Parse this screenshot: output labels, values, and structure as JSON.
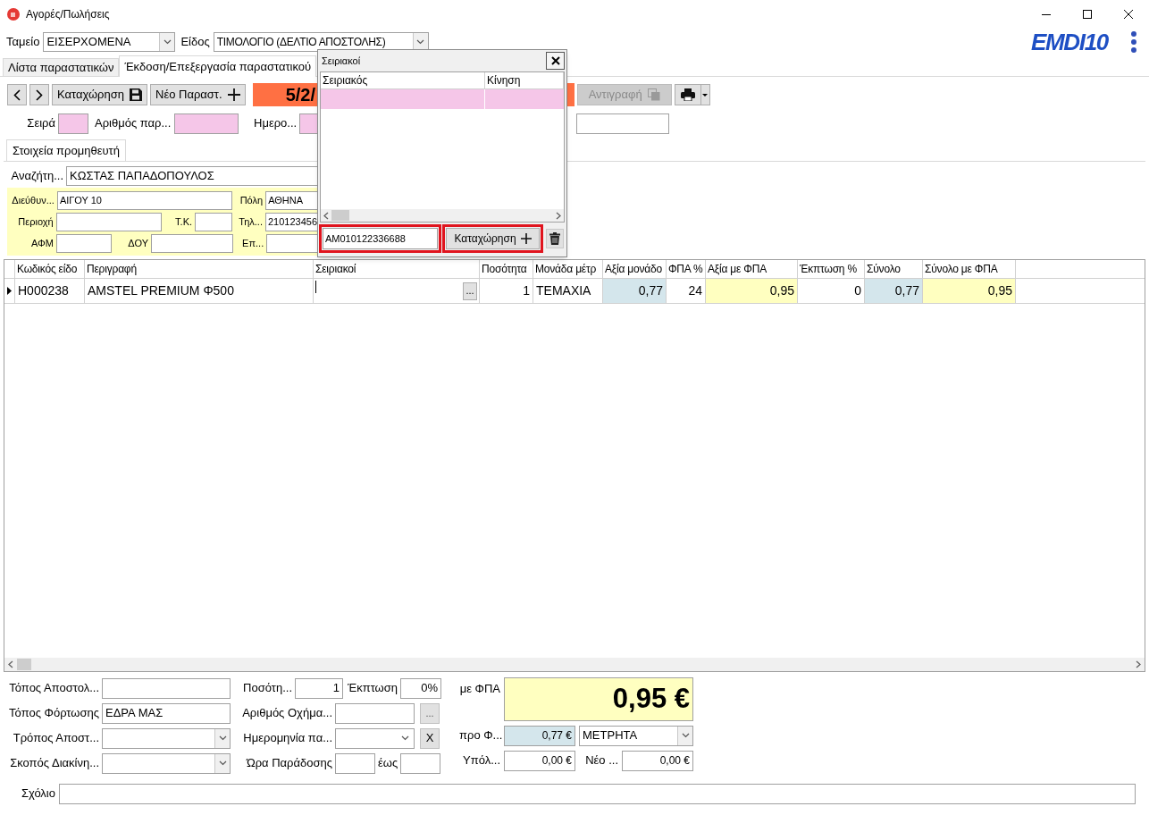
{
  "window": {
    "title": "Αγορές/Πωλήσεις"
  },
  "header": {
    "cash_box": {
      "label": "Ταμείο",
      "value": "ΕΙΣΕΡΧΟΜΕΝΑ"
    },
    "doc_type": {
      "label": "Είδος",
      "value": "ΤΙΜΟΛΟΓΙΟ (ΔΕΛΤΙΟ ΑΠΟΣΤΟΛΗΣ)"
    },
    "logo": "EMDI10"
  },
  "tabs": [
    {
      "label": "Λίστα παραστατικών",
      "selected": false
    },
    {
      "label": "Έκδοση/Επεξεργασία παραστατικού",
      "selected": true
    }
  ],
  "toolbar": {
    "buttons": [
      {
        "kind": "prev",
        "disabled": false
      },
      {
        "kind": "next",
        "disabled": false
      },
      {
        "kind": "save",
        "label": "Καταχώρηση",
        "disabled": false
      },
      {
        "kind": "new",
        "label": "Νέο Παραστ.",
        "disabled": false
      }
    ],
    "date_banner": "5/2/",
    "copy_button": {
      "label": "Αντιγραφή",
      "disabled": true
    }
  },
  "document_fields": [
    {
      "label": "Σειρά",
      "highlighted": true
    },
    {
      "label": "Αριθμός παρ...",
      "highlighted": true
    },
    {
      "label": "Ημερο...",
      "highlighted": true
    },
    {
      "highlighted": false
    }
  ],
  "supplier": {
    "tab": "Στοιχεία προμηθευτή",
    "search": {
      "label": "Αναζήτη...",
      "value": "ΚΩΣΤΑΣ ΠΑΠΑΔΟΠΟΥΛΟΣ"
    },
    "address": {
      "label": "Διεύθυν...",
      "value": "ΑΙΓΟΥ 10"
    },
    "city": {
      "label": "Πόλη",
      "value": "ΑΘΗΝΑ"
    },
    "area": {
      "label": "Περιοχή"
    },
    "postal_code": {
      "label": "Τ.Κ."
    },
    "phone": {
      "label": "Τηλ...",
      "value": "210123456"
    },
    "tax_id": {
      "label": "ΑΦΜ"
    },
    "tax_office": {
      "label": "ΔΟΥ"
    },
    "field_9": {
      "label": "Επ..."
    }
  },
  "grid": {
    "columns": [
      "Κωδικός είδο",
      "Περιγραφή",
      "Σειριακοί",
      "Ποσότητα",
      "Μονάδα μέτρ",
      "Αξία μονάδο",
      "ΦΠΑ %",
      "Αξία με ΦΠΑ",
      "Έκπτωση %",
      "Σύνολο",
      "Σύνολο με ΦΠΑ"
    ],
    "rows": [
      {
        "current": true,
        "code": "H000238",
        "description": "AMSTEL PREMIUM Φ500",
        "serial_button": "...",
        "quantity": "1",
        "unit": "ΤΕΜΑΧΙΑ",
        "unit_value": "0,77",
        "vat_percent": "24",
        "value_with_vat": "0,95",
        "discount_percent": "0",
        "total": "0,77",
        "total_with_vat": "0,95"
      }
    ]
  },
  "serials_dialog": {
    "title": "Σειριακοί",
    "columns": [
      "Σειριακός",
      "Κίνηση"
    ],
    "rows": [
      {
        "highlighted": true
      }
    ],
    "input": "AM010122336688",
    "add_button": "Καταχώρηση"
  },
  "footer": {
    "left": [
      {
        "label": "Τόπος Αποστολ...",
        "kind": "text"
      },
      {
        "label": "Τόπος Φόρτωσης",
        "kind": "text",
        "value": "ΕΔΡΑ ΜΑΣ"
      },
      {
        "label": "Τρόπος Αποστ...",
        "kind": "combo"
      },
      {
        "label": "Σκοπός Διακίνη...",
        "kind": "combo"
      }
    ],
    "quantity": {
      "label": "Ποσότη...",
      "value": "1"
    },
    "discount": {
      "label": "Έκπτωση",
      "value": "0%"
    },
    "vehicle": {
      "label": "Αριθμός Οχήμα...",
      "button": "..."
    },
    "delivery_date": {
      "label": "Ημερομηνία πα...",
      "clear_button": "X"
    },
    "delivery_time": {
      "label": "Ώρα Παράδοσης",
      "to_label": "έως"
    },
    "total_with_vat": {
      "label": "με ΦΠΑ",
      "value": "0,95 €"
    },
    "total_before_vat": {
      "label": "προ Φ...",
      "value": "0,77 €"
    },
    "payment": {
      "value": "ΜΕΤΡΗΤΑ"
    },
    "balance": {
      "label": "Υπόλ...",
      "value": "0,00 €"
    },
    "new_balance": {
      "label": "Νέο ...",
      "value": "0,00 €"
    },
    "comment": {
      "label": "Σχόλιο"
    }
  }
}
